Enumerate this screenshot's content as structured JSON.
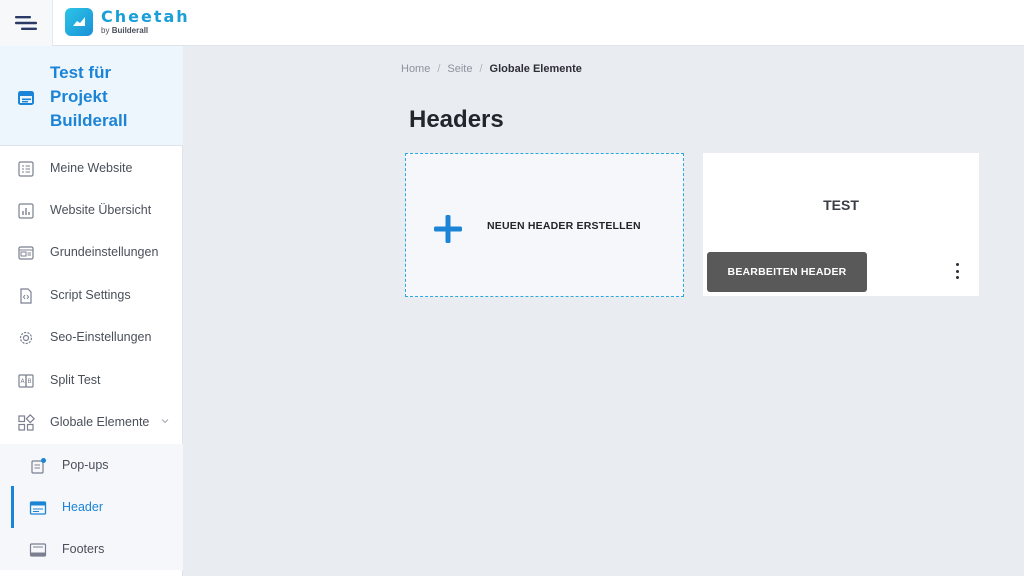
{
  "app": {
    "logo_name": "Cheetah",
    "logo_by": "by",
    "logo_brand": "Builderall"
  },
  "project": {
    "title": "Test für Projekt Builderall"
  },
  "sidebar": {
    "items": [
      {
        "label": "Meine Website",
        "icon": "list-icon"
      },
      {
        "label": "Website Übersicht",
        "icon": "chart-icon"
      },
      {
        "label": "Grundeinstellungen",
        "icon": "settings-window-icon"
      },
      {
        "label": "Script Settings",
        "icon": "code-file-icon"
      },
      {
        "label": "Seo-Einstellungen",
        "icon": "gear-icon"
      },
      {
        "label": "Split Test",
        "icon": "split-icon"
      },
      {
        "label": "Globale Elemente",
        "icon": "grid-icon"
      }
    ],
    "subitems": [
      {
        "label": "Pop-ups",
        "icon": "popup-icon"
      },
      {
        "label": "Header",
        "icon": "header-layout-icon"
      },
      {
        "label": "Footers",
        "icon": "footer-layout-icon"
      }
    ]
  },
  "breadcrumb": {
    "home": "Home",
    "page": "Seite",
    "current": "Globale Elemente",
    "separator": "/"
  },
  "main": {
    "title": "Headers",
    "create_label": "NEUEN HEADER ERSTELLEN",
    "header_card": {
      "name": "TEST",
      "edit_label": "BEARBEITEN HEADER"
    }
  },
  "colors": {
    "accent": "#1b84d6",
    "dashed_border": "#2aa8e0",
    "edit_button": "#595959",
    "background": "#e9ecf1"
  }
}
